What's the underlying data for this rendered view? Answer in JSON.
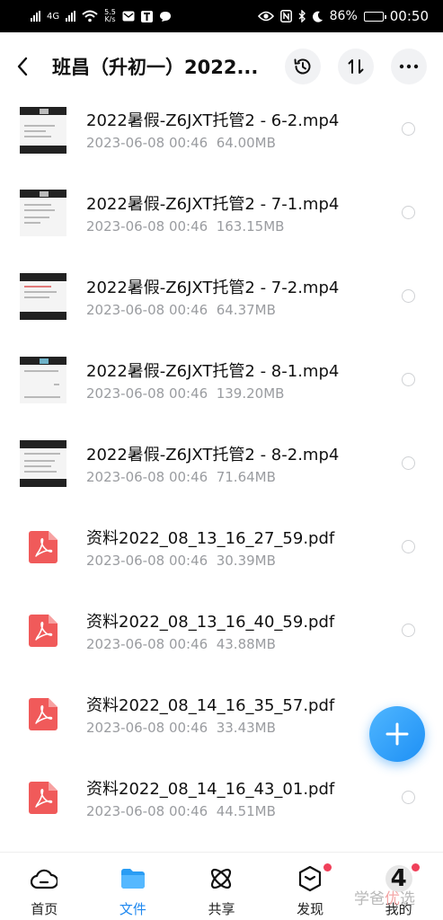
{
  "status_bar": {
    "network_type": "4G",
    "speed_value": "5.5",
    "speed_unit": "K/s",
    "battery": "86%",
    "battery_level": 0.86,
    "time": "00:50"
  },
  "header": {
    "title": "班昌（升初一）2022..."
  },
  "files": [
    {
      "name": "2022暑假-Z6JXT托管2 - 6-2.mp4",
      "date": "2023-06-08  00:46",
      "size": "64.00MB",
      "kind": "video"
    },
    {
      "name": "2022暑假-Z6JXT托管2 - 7-1.mp4",
      "date": "2023-06-08  00:46",
      "size": "163.15MB",
      "kind": "video"
    },
    {
      "name": "2022暑假-Z6JXT托管2 - 7-2.mp4",
      "date": "2023-06-08  00:46",
      "size": "64.37MB",
      "kind": "video"
    },
    {
      "name": "2022暑假-Z6JXT托管2 - 8-1.mp4",
      "date": "2023-06-08  00:46",
      "size": "139.20MB",
      "kind": "video"
    },
    {
      "name": "2022暑假-Z6JXT托管2 - 8-2.mp4",
      "date": "2023-06-08  00:46",
      "size": "71.64MB",
      "kind": "video"
    },
    {
      "name": "资料2022_08_13_16_27_59.pdf",
      "date": "2023-06-08  00:46",
      "size": "30.39MB",
      "kind": "pdf"
    },
    {
      "name": "资料2022_08_13_16_40_59.pdf",
      "date": "2023-06-08  00:46",
      "size": "43.88MB",
      "kind": "pdf"
    },
    {
      "name": "资料2022_08_14_16_35_57.pdf",
      "date": "2023-06-08  00:46",
      "size": "33.43MB",
      "kind": "pdf"
    },
    {
      "name": "资料2022_08_14_16_43_01.pdf",
      "date": "2023-06-08  00:46",
      "size": "44.51MB",
      "kind": "pdf"
    }
  ],
  "bottom_nav": {
    "items": [
      {
        "label": "首页",
        "icon": "cloud-home-icon"
      },
      {
        "label": "文件",
        "icon": "folder-icon"
      },
      {
        "label": "共享",
        "icon": "share-atom-icon"
      },
      {
        "label": "发现",
        "icon": "discover-cube-icon"
      },
      {
        "label": "我的",
        "icon": "avatar-icon"
      }
    ],
    "avatar_text": "4"
  },
  "watermark": {
    "text_a": "学爸",
    "text_b": "优",
    "text_c": "选"
  },
  "colors": {
    "accent": "#1e88f0",
    "badge_red": "#f0405a",
    "pdf_red": "#f05a5a",
    "meta_gray": "#9a9ca0"
  }
}
